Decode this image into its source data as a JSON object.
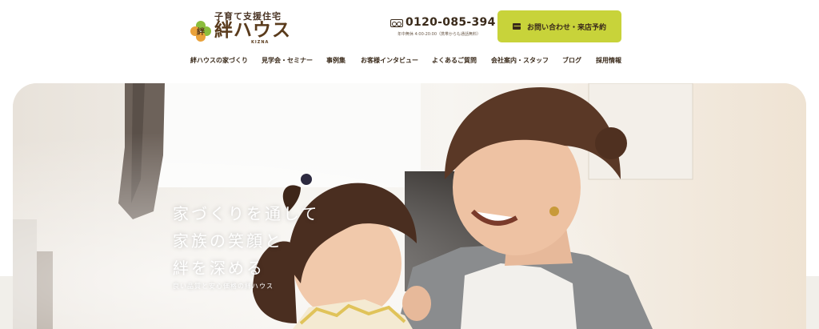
{
  "logo": {
    "tagline": "子育て支援住宅",
    "name": "絆ハウス",
    "romanized": "KIZNA",
    "mark_char": "絆"
  },
  "phone": {
    "icon": "free-dial-icon",
    "number": "0120-085-394",
    "hours": "年中無休 4:00-20:00（携帯からも通話無料）"
  },
  "contact_button": {
    "icon": "mail-icon",
    "label": "お問い合わせ・来店予約"
  },
  "nav": {
    "items": [
      "絆ハウスの家づくり",
      "見学会・セミナー",
      "事例集",
      "お客様インタビュー",
      "よくあるご質問",
      "会社案内・スタッフ",
      "ブログ",
      "採用情報"
    ]
  },
  "hero": {
    "headline": [
      "家づくりを通して",
      "家族の笑顔と",
      "絆を深める"
    ],
    "subcopy": "良い品質と安心価格の絆ハウス"
  },
  "colors": {
    "accent": "#c8d33a",
    "text": "#3a2a1a",
    "logo_green": "#8bbd3c",
    "logo_orange": "#e9a13a"
  }
}
